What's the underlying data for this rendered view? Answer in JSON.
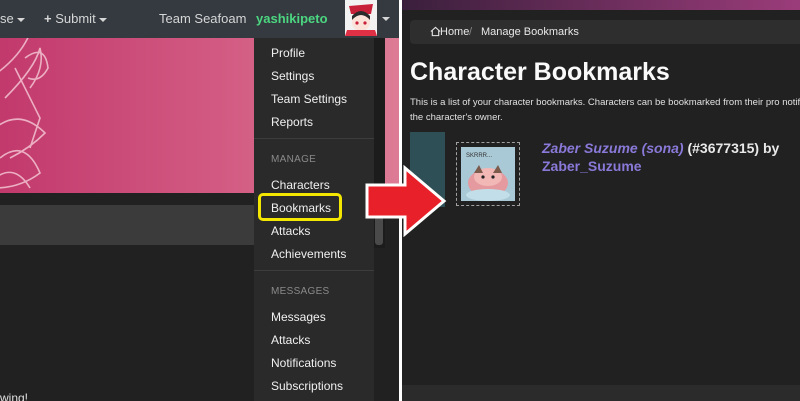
{
  "left_panel": {
    "nav": {
      "browse_label_partial": "se",
      "submit_label": "Submit",
      "team_label": "Team Seafoam",
      "username": "yashikipeto"
    },
    "dropdown": {
      "items": [
        {
          "label": "Profile"
        },
        {
          "label": "Settings"
        },
        {
          "label": "Team Settings"
        },
        {
          "label": "Reports"
        }
      ],
      "manage_header": "MANAGE",
      "manage_items": [
        {
          "label": "Characters"
        },
        {
          "label": "Bookmarks"
        },
        {
          "label": "Attacks"
        },
        {
          "label": "Achievements"
        }
      ],
      "messages_header": "MESSAGES",
      "message_items": [
        {
          "label": "Messages"
        },
        {
          "label": "Attacks"
        },
        {
          "label": "Notifications"
        },
        {
          "label": "Subscriptions"
        }
      ]
    },
    "bottom_text": "wing!"
  },
  "right_panel": {
    "breadcrumb": {
      "home": "Home",
      "current": "Manage Bookmarks"
    },
    "title": "Character Bookmarks",
    "description": "This is a list of your character bookmarks. Characters can be bookmarked from their pro notifying the character's owner.",
    "bookmark": {
      "character_name": "Zaber Suzume (sona)",
      "character_id": "(#3677315) by",
      "owner": "Zaber_Suzume",
      "thumb_caption": "SKRRR..."
    }
  },
  "colors": {
    "highlight": "#f3e600",
    "arrow": "#e8202a",
    "link": "#8a79d8",
    "username": "#4cd680"
  }
}
